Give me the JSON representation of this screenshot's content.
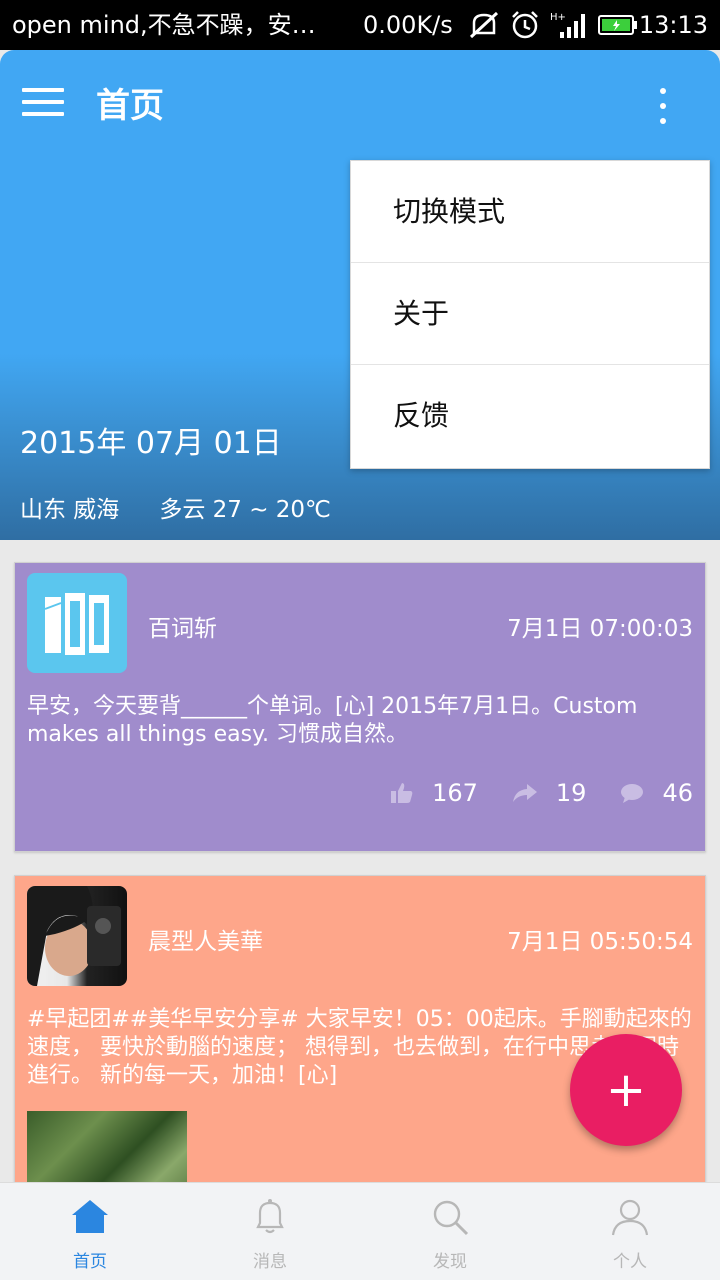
{
  "status_bar": {
    "notification": "open mind,不急不躁，安…",
    "speed": "0.00K/s",
    "time": "13:13"
  },
  "header": {
    "title": "首页",
    "date": "2015年 07月 01日",
    "location": "山东 威海",
    "weather": "多云 27 ~ 20℃",
    "background_color": "#41a7f3"
  },
  "dropdown_menu": {
    "items": [
      {
        "label": "切换模式"
      },
      {
        "label": "关于"
      },
      {
        "label": "反馈"
      }
    ]
  },
  "feed": {
    "posts": [
      {
        "user": "百词斩",
        "time": "7月1日 07:00:03",
        "text": "早安，今天要背______个单词。[心] 2015年7月1日。Custom makes all things easy. 习惯成自然。",
        "likes": "167",
        "reposts": "19",
        "comments": "46",
        "color": "#a08ccc"
      },
      {
        "user": "晨型人美華",
        "time": "7月1日 05:50:54",
        "text": "#早起团##美华早安分享# 大家早安！05：00起床。手腳動起來的速度， 要快於動腦的速度； 想得到，也去做到，在行中思考的同時進行。 新的每一天，加油！[心]",
        "color": "#fea68a"
      }
    ]
  },
  "fab": {
    "label": "+",
    "color": "#e91e63"
  },
  "bottom_nav": {
    "items": [
      {
        "label": "首页",
        "icon": "home-icon"
      },
      {
        "label": "消息",
        "icon": "bell-icon"
      },
      {
        "label": "发现",
        "icon": "search-icon"
      },
      {
        "label": "个人",
        "icon": "person-icon"
      }
    ],
    "active_color": "#2b86e0"
  }
}
